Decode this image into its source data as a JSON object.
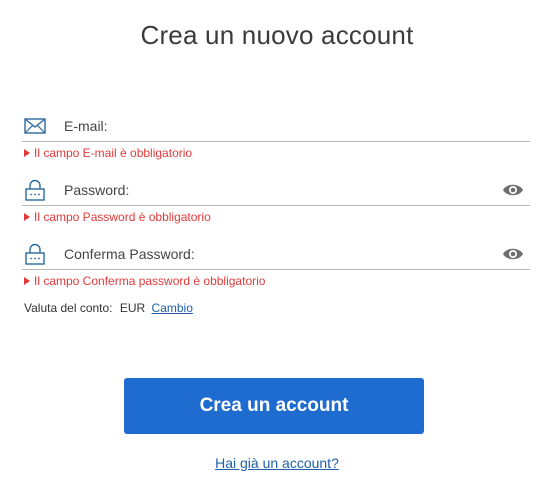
{
  "title": "Crea un nuovo account",
  "fields": {
    "email": {
      "label": "E-mail:",
      "icon": "envelope-icon",
      "error": "Il campo E-mail è obbligatorio"
    },
    "password": {
      "label": "Password:",
      "icon": "lock-icon",
      "toggle_icon": "eye-icon",
      "error": "Il campo Password è obbligatorio"
    },
    "confirm_password": {
      "label": "Conferma Password:",
      "icon": "lock-icon",
      "toggle_icon": "eye-icon",
      "error": "Il campo Conferma password è obbligatorio"
    }
  },
  "currency": {
    "label": "Valuta del conto:",
    "value": "EUR",
    "change_link": "Cambio"
  },
  "submit_label": "Crea un account",
  "login_link": "Hai già un account?",
  "colors": {
    "primary": "#1e6ccf",
    "error": "#e23a3a",
    "link": "#1f5fa8",
    "icon": "#2c6aa0"
  }
}
